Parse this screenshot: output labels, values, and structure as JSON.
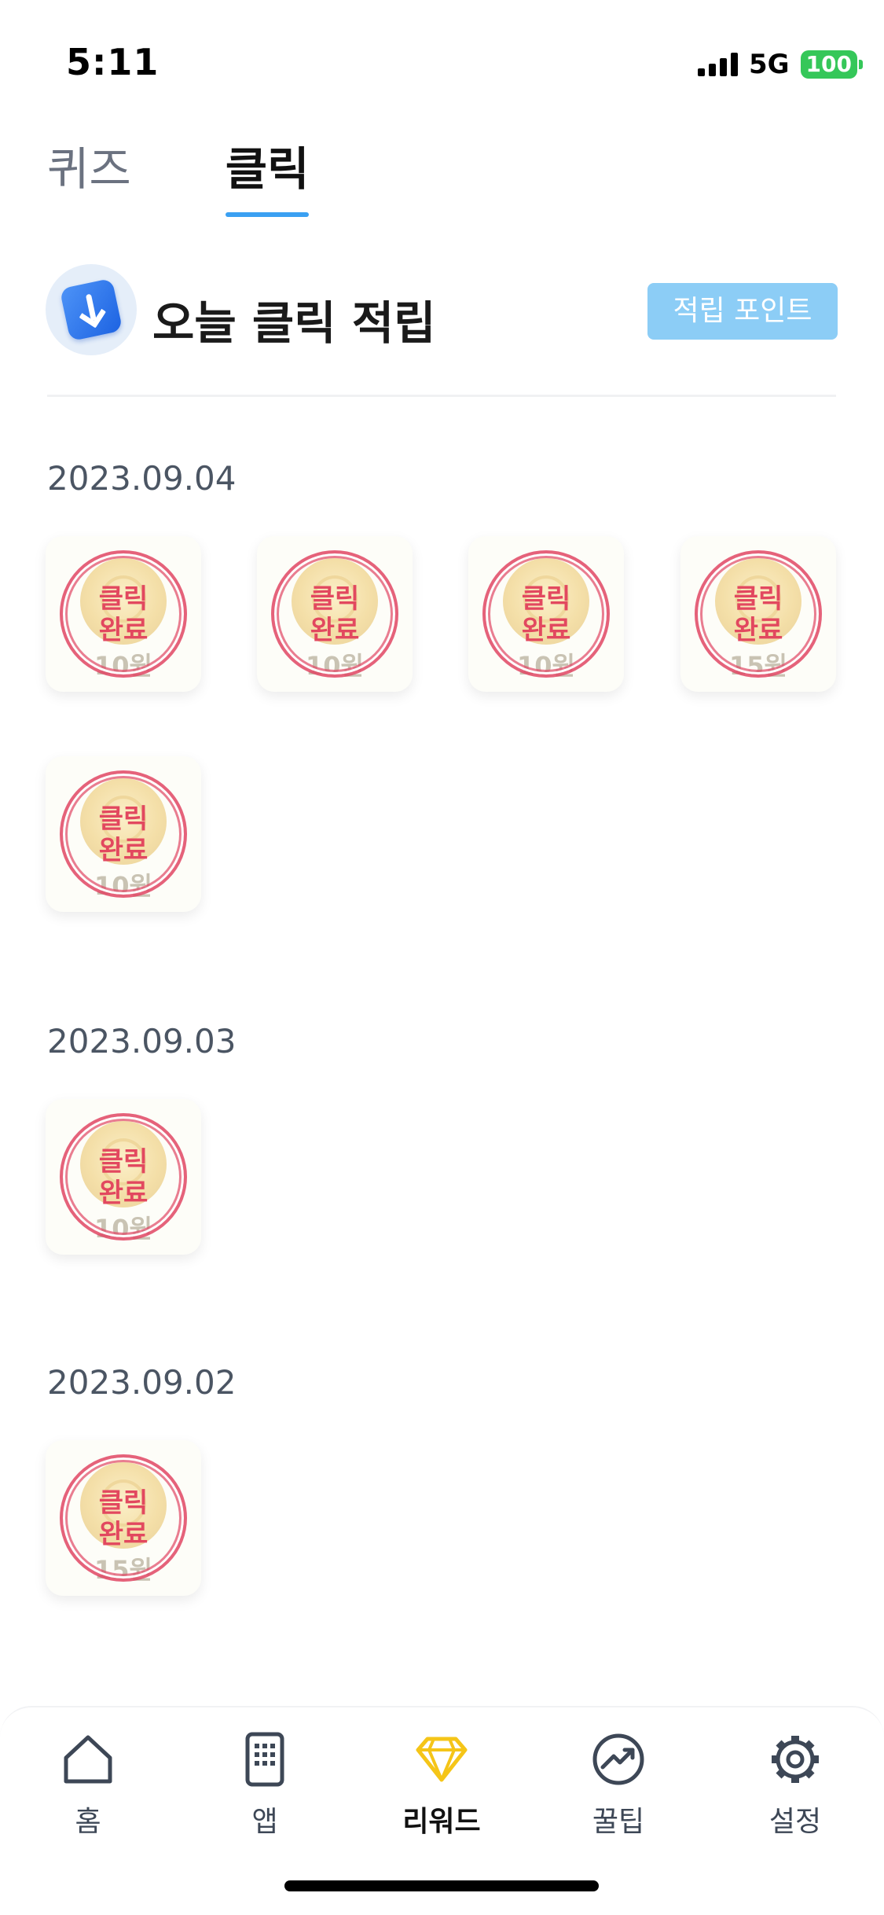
{
  "status_bar": {
    "time": "5:11",
    "network": "5G",
    "battery": "100"
  },
  "top_tabs": [
    {
      "label": "퀴즈",
      "active": false
    },
    {
      "label": "클릭",
      "active": true
    }
  ],
  "section": {
    "title": "오늘 클릭 적립",
    "points_button": "적립 포인트"
  },
  "stamp_label": {
    "line1": "클릭",
    "line2": "완료"
  },
  "groups": [
    {
      "date": "2023.09.04",
      "tiles": [
        {
          "amount": "10원"
        },
        {
          "amount": "10원"
        },
        {
          "amount": "10원"
        },
        {
          "amount": "15원"
        },
        {
          "amount": "10원"
        }
      ]
    },
    {
      "date": "2023.09.03",
      "tiles": [
        {
          "amount": "10원"
        }
      ]
    },
    {
      "date": "2023.09.02",
      "tiles": [
        {
          "amount": "15원"
        }
      ]
    }
  ],
  "bottom_nav": [
    {
      "label": "홈",
      "icon": "home-icon",
      "active": false
    },
    {
      "label": "앱",
      "icon": "app-icon",
      "active": false
    },
    {
      "label": "리워드",
      "icon": "diamond-icon",
      "active": true
    },
    {
      "label": "꿀팁",
      "icon": "trend-icon",
      "active": false
    },
    {
      "label": "설정",
      "icon": "gear-icon",
      "active": false
    }
  ],
  "colors": {
    "accent": "#3aa0f2",
    "reward_active": "#f5c518",
    "stamp": "#e2485f"
  }
}
